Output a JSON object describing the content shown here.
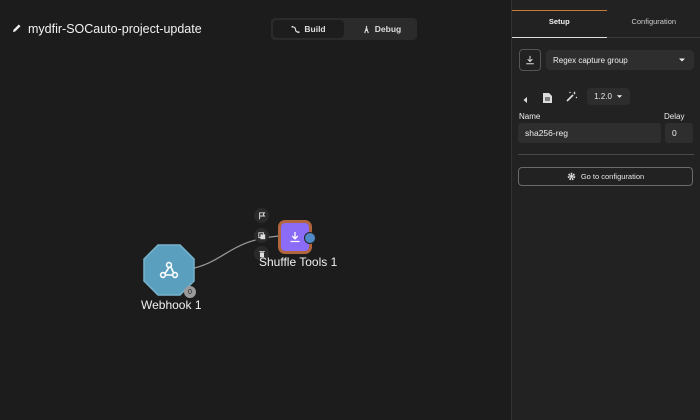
{
  "header": {
    "title": "mydfir-SOCauto-project-update"
  },
  "mode_toggle": {
    "build_label": "Build",
    "debug_label": "Debug"
  },
  "nodes": {
    "webhook": {
      "label": "Webhook 1",
      "badge": "0"
    },
    "shuffle": {
      "label": "Shuffle Tools 1"
    }
  },
  "panel": {
    "tabs": [
      {
        "label": "Setup"
      },
      {
        "label": "Configuration"
      }
    ],
    "action_select": {
      "value": "Regex capture group"
    },
    "version": "1.2.0",
    "name_label": "Name",
    "name_value": "sha256-reg",
    "delay_label": "Delay",
    "delay_value": "0",
    "config_button": "Go to configuration"
  },
  "colors": {
    "accent_purple": "#8b6cf6",
    "node_border_orange": "#b0653c",
    "webhook_blue": "#5b9fbf",
    "tab_accent": "#c97b3a"
  }
}
